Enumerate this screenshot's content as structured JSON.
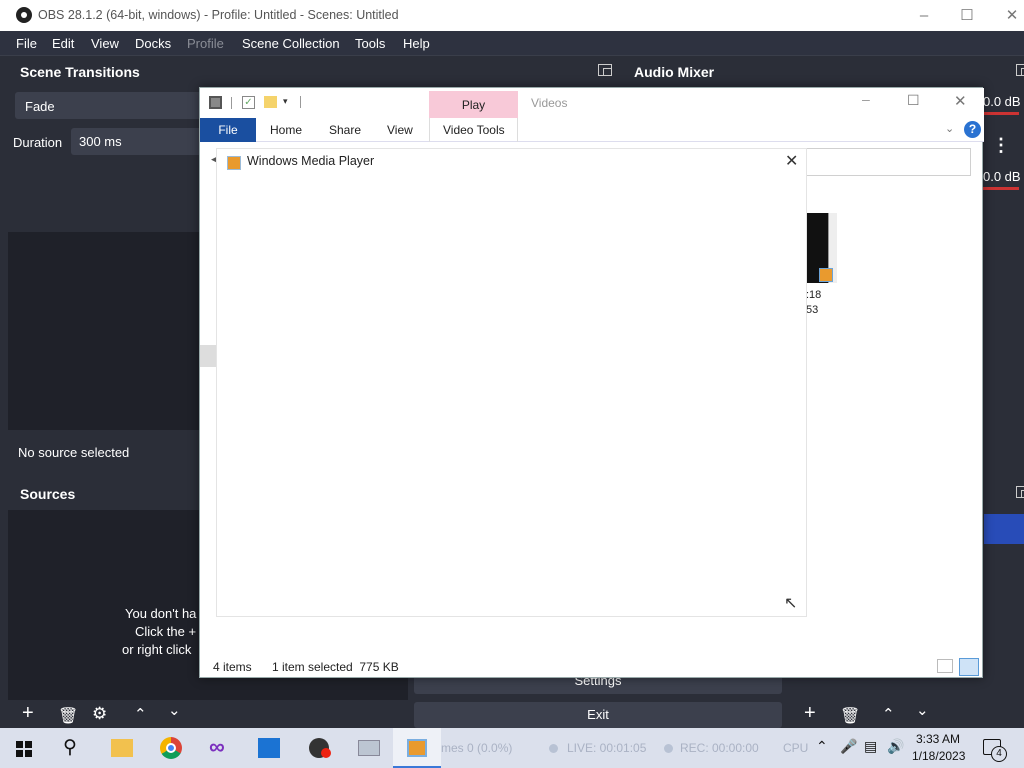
{
  "obs": {
    "title": "OBS 28.1.2 (64-bit, windows) - Profile: Untitled - Scenes: Untitled",
    "menu": [
      "File",
      "Edit",
      "View",
      "Docks",
      "Profile",
      "Scene Collection",
      "Tools",
      "Help"
    ],
    "scene_transitions": {
      "title": "Scene Transitions",
      "transition": "Fade",
      "duration_label": "Duration",
      "duration_value": "300 ms"
    },
    "audio_mixer": {
      "title": "Audio Mixer",
      "levels": [
        "0.0 dB",
        "0.0 dB"
      ]
    },
    "no_source": "No source selected",
    "sources": {
      "title": "Sources",
      "empty_line1": "You don't ha",
      "empty_line2": "Click the +",
      "empty_line3": "or right click"
    },
    "controls": {
      "settings": "Settings",
      "exit": "Exit"
    },
    "status": {
      "frames": "mes 0 (0.0%)",
      "live": "LIVE: 00:01:05",
      "rec": "REC: 00:00:00",
      "cpu": "CPU"
    }
  },
  "explorer": {
    "play_tab": "Play",
    "title": "Videos",
    "tabs": [
      "File",
      "Home",
      "Share",
      "View",
      "Video Tools"
    ],
    "thumb_label_1": ":18",
    "thumb_label_2": "53",
    "status_items": "4 items",
    "status_selected": "1 item selected  775 KB"
  },
  "wmp": {
    "title": "Windows Media Player"
  },
  "taskbar": {
    "time": "3:33 AM",
    "date": "1/18/2023",
    "notifications": "4"
  },
  "colors": {
    "obs_bg": "#2b2e38",
    "file_tab": "#1a4fa0",
    "play_tab": "#f8c9d8",
    "taskbar": "#dbe0ec"
  }
}
